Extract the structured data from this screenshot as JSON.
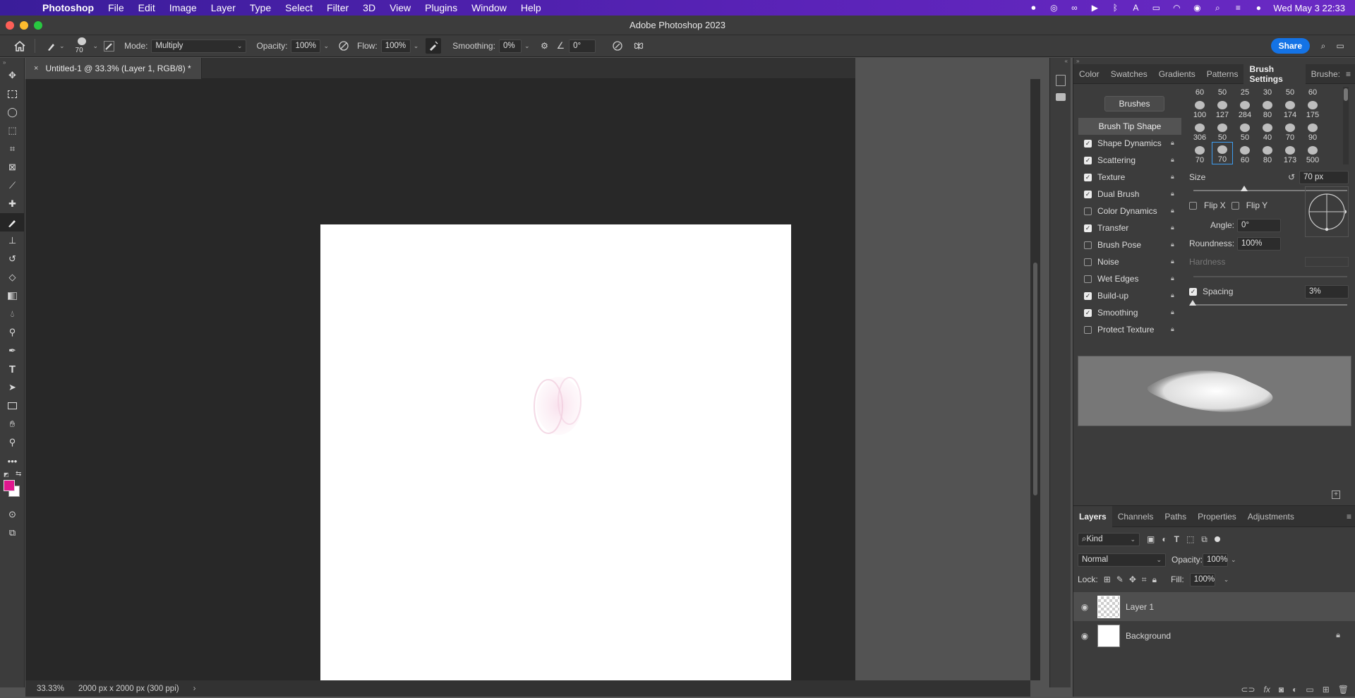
{
  "menubar": {
    "app": "Photoshop",
    "items": [
      "File",
      "Edit",
      "Image",
      "Layer",
      "Type",
      "Select",
      "Filter",
      "3D",
      "View",
      "Plugins",
      "Window",
      "Help"
    ],
    "clock": "Wed May 3  22:33"
  },
  "window": {
    "title": "Adobe Photoshop 2023"
  },
  "options": {
    "brush_size": "70",
    "mode_label": "Mode:",
    "mode_value": "Multiply",
    "opacity_label": "Opacity:",
    "opacity_value": "100%",
    "flow_label": "Flow:",
    "flow_value": "100%",
    "smoothing_label": "Smoothing:",
    "smoothing_value": "0%",
    "angle_value": "0°",
    "share_label": "Share"
  },
  "document": {
    "tab_title": "Untitled-1 @ 33.3% (Layer 1, RGB/8) *",
    "zoom": "33.33%",
    "info": "2000 px x 2000 px (300 ppi)"
  },
  "colors": {
    "foreground": "#e0178f",
    "background": "#ffffff"
  },
  "brush_panel": {
    "tabs": [
      "Color",
      "Swatches",
      "Gradients",
      "Patterns",
      "Brush Settings",
      "Brushe:"
    ],
    "active_tab": "Brush Settings",
    "brushes_button": "Brushes",
    "tip_shape": "Brush Tip Shape",
    "options": [
      {
        "label": "Shape Dynamics",
        "checked": true
      },
      {
        "label": "Scattering",
        "checked": true
      },
      {
        "label": "Texture",
        "checked": true
      },
      {
        "label": "Dual Brush",
        "checked": true
      },
      {
        "label": "Color Dynamics",
        "checked": false
      },
      {
        "label": "Transfer",
        "checked": true
      },
      {
        "label": "Brush Pose",
        "checked": false
      },
      {
        "label": "Noise",
        "checked": false
      },
      {
        "label": "Wet Edges",
        "checked": false
      },
      {
        "label": "Build-up",
        "checked": true
      },
      {
        "label": "Smoothing",
        "checked": true
      },
      {
        "label": "Protect Texture",
        "checked": false
      }
    ],
    "preset_rows": [
      [
        "60",
        "50",
        "25",
        "30",
        "50",
        "60"
      ],
      [
        "100",
        "127",
        "284",
        "80",
        "174",
        "175"
      ],
      [
        "306",
        "50",
        "50",
        "40",
        "70",
        "90"
      ],
      [
        "70",
        "70",
        "60",
        "80",
        "173",
        "500"
      ]
    ],
    "size_label": "Size",
    "size_value": "70 px",
    "flipx": "Flip X",
    "flipy": "Flip Y",
    "angle_label": "Angle:",
    "angle_value": "0°",
    "roundness_label": "Roundness:",
    "roundness_value": "100%",
    "hardness_label": "Hardness",
    "spacing_label": "Spacing",
    "spacing_value": "3%"
  },
  "layers_panel": {
    "tabs": [
      "Layers",
      "Channels",
      "Paths",
      "Properties",
      "Adjustments"
    ],
    "kind": "Kind",
    "blend": "Normal",
    "opacity_label": "Opacity:",
    "opacity_value": "100%",
    "lock_label": "Lock:",
    "fill_label": "Fill:",
    "fill_value": "100%",
    "layers": [
      {
        "name": "Layer 1"
      },
      {
        "name": "Background"
      }
    ]
  }
}
